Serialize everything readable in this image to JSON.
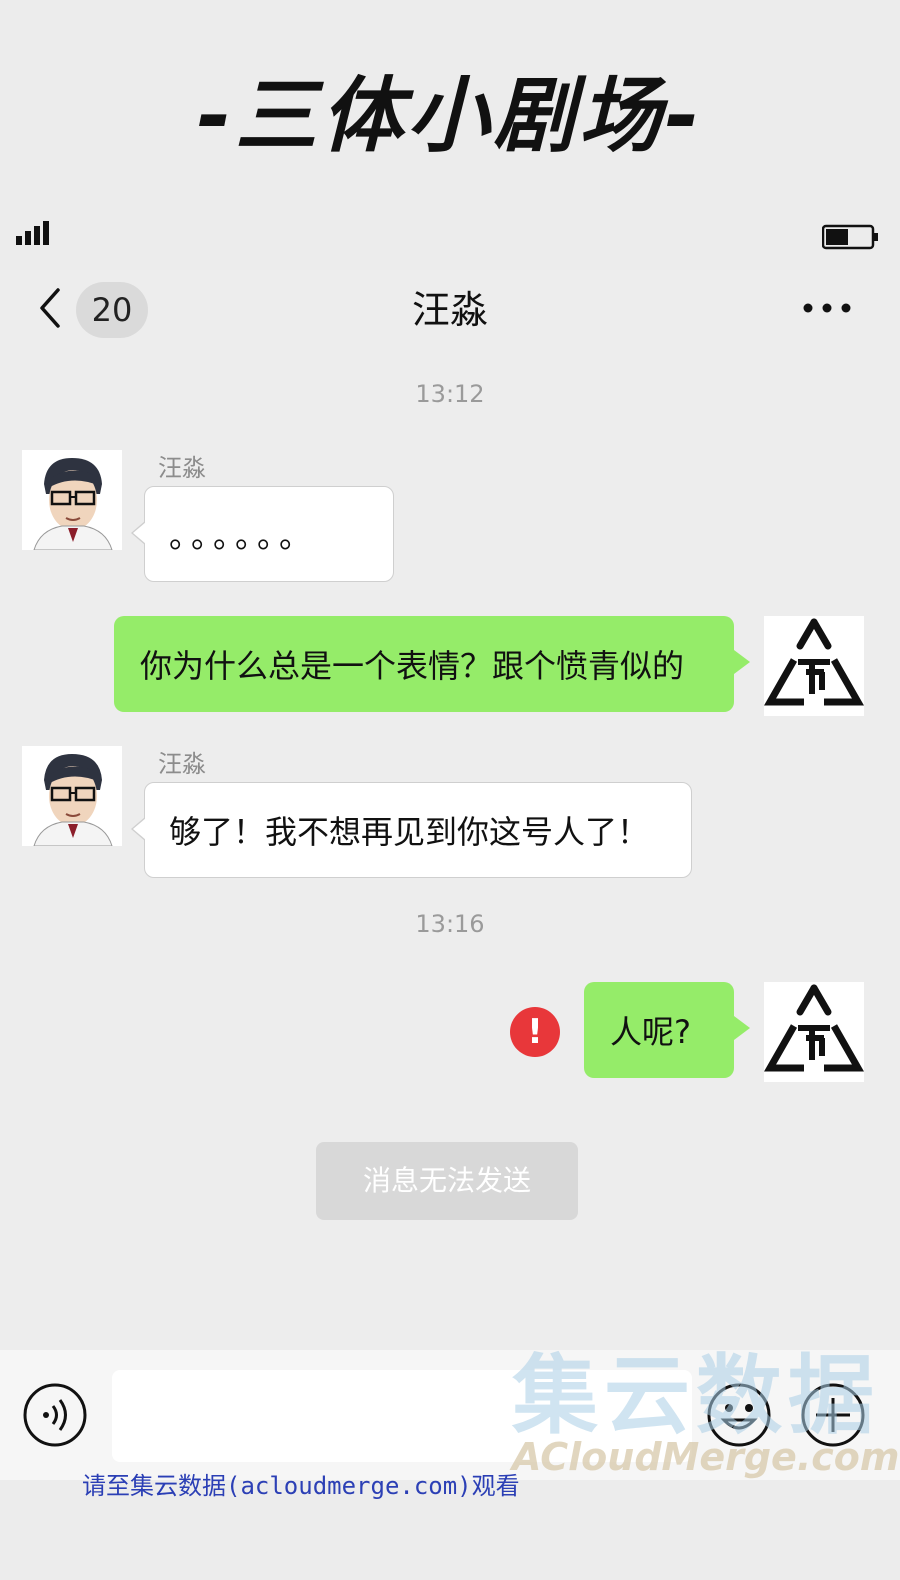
{
  "banner": {
    "title": "-三体小剧场-"
  },
  "nav": {
    "unread_count": "20",
    "title": "汪淼"
  },
  "messages": [
    {
      "type": "timestamp",
      "text": "13:12"
    },
    {
      "type": "incoming",
      "sender": "汪淼",
      "text": "。。。。。。"
    },
    {
      "type": "outgoing",
      "text": "你为什么总是一个表情？跟个愤青似的"
    },
    {
      "type": "incoming",
      "sender": "汪淼",
      "text": "够了！我不想再见到你这号人了！"
    },
    {
      "type": "timestamp",
      "text": "13:16"
    },
    {
      "type": "outgoing",
      "text": "人呢?",
      "status": "failed"
    },
    {
      "type": "system",
      "text": "消息无法发送"
    }
  ],
  "icons": {
    "back": "chevron-left-icon",
    "more": "more-dots-icon",
    "error": "exclamation-icon",
    "voice": "voice-icon",
    "emoji": "emoji-icon",
    "plus": "plus-icon"
  },
  "colors": {
    "outgoing_bubble": "#95ec69",
    "incoming_bubble": "#ffffff",
    "chat_background": "#ededed",
    "error": "#e8373a"
  },
  "watermark": {
    "cn": "集云数据",
    "en": "ACloudMerge.com"
  },
  "footer": {
    "text": "请至集云数据(acloudmerge.com)观看"
  }
}
